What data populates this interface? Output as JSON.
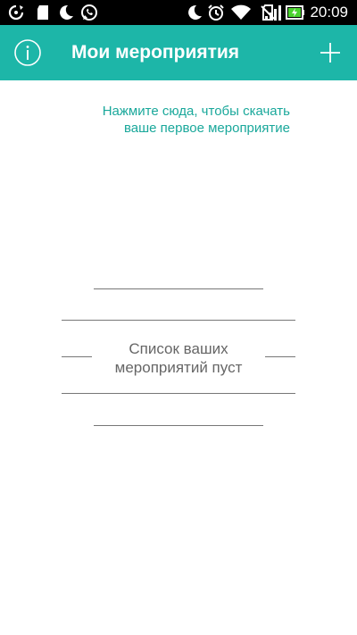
{
  "status_bar": {
    "time": "20:09",
    "battery_color": "#4ad22e",
    "left_icons": [
      "sync-icon",
      "sd-card-icon",
      "moon-icon",
      "whatsapp-icon"
    ],
    "right_icons": [
      "moon-icon",
      "alarm-icon",
      "wifi-icon",
      "no-sim-icon",
      "signal-icon",
      "battery-charging-icon"
    ]
  },
  "app_bar": {
    "background": "#1db6a8",
    "title": "Мои мероприятия",
    "left_icon": "info-icon",
    "right_icon": "plus-icon"
  },
  "hint": {
    "line1": "Нажмите сюда, чтобы скачать",
    "line2": "ваше первое мероприятие",
    "color": "#1aa89b"
  },
  "empty_state": {
    "line1": "Список ваших",
    "line2": "мероприятий пуст"
  }
}
